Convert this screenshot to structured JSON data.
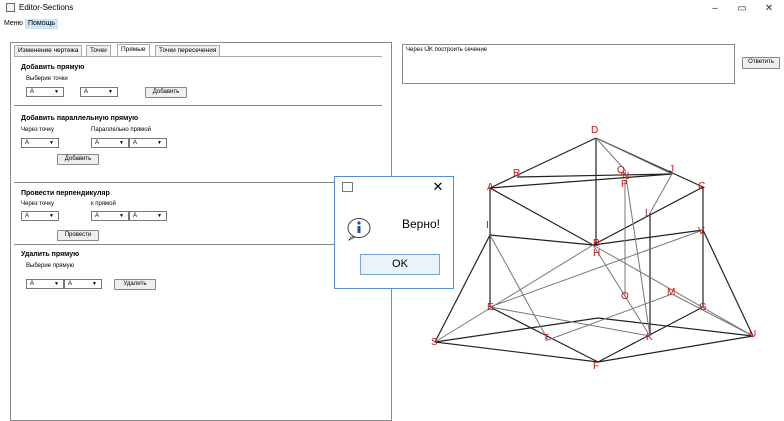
{
  "window": {
    "title": "Editor-Sections",
    "minimize": "–",
    "maximize": "▭",
    "close": "✕"
  },
  "menu": [
    {
      "label": "Меню"
    },
    {
      "label": "Помощь"
    }
  ],
  "tabs": [
    {
      "label": "Изменение чертежа"
    },
    {
      "label": "Точки"
    },
    {
      "label": "Прямые"
    },
    {
      "label": "Точки пересечения"
    }
  ],
  "add_line": {
    "heading": "Добавить прямую",
    "hint": "Выберие точки",
    "point1": "A",
    "point2": "A",
    "button": "Добавить"
  },
  "add_parallel": {
    "heading": "Добавить параллельную прямую",
    "through_label": "Через точку",
    "parallel_label": "Параллельно прямой",
    "point": "A",
    "line_p1": "A",
    "line_p2": "A",
    "button": "Добавить"
  },
  "perpendicular": {
    "heading": "Провести перпендикуляр",
    "through_label": "Через точку",
    "to_line_label": "к прямой",
    "point": "A",
    "line_p1": "A",
    "line_p2": "A",
    "button": "Провести"
  },
  "delete_line": {
    "heading": "Удалить прямую",
    "hint": "Выберие прямую",
    "p1": "A",
    "p2": "A",
    "button": "Удалить"
  },
  "task": {
    "text": "Через IJK построить сечение",
    "answer_button": "Ответить"
  },
  "dialog": {
    "message": "Верно!",
    "ok": "OK",
    "close": "✕"
  },
  "figure_labels": [
    "D",
    "R",
    "Q",
    "N",
    "P",
    "J",
    "A",
    "C",
    "L",
    "I",
    "V",
    "B",
    "H",
    "O",
    "M",
    "E",
    "G",
    "S",
    "T",
    "K",
    "U",
    "F"
  ],
  "colors": {
    "label": "#cc1111",
    "tab_selected": "#ffffff",
    "menu_highlight": "#cce4f7",
    "dialog_border": "#5a8ecb"
  }
}
